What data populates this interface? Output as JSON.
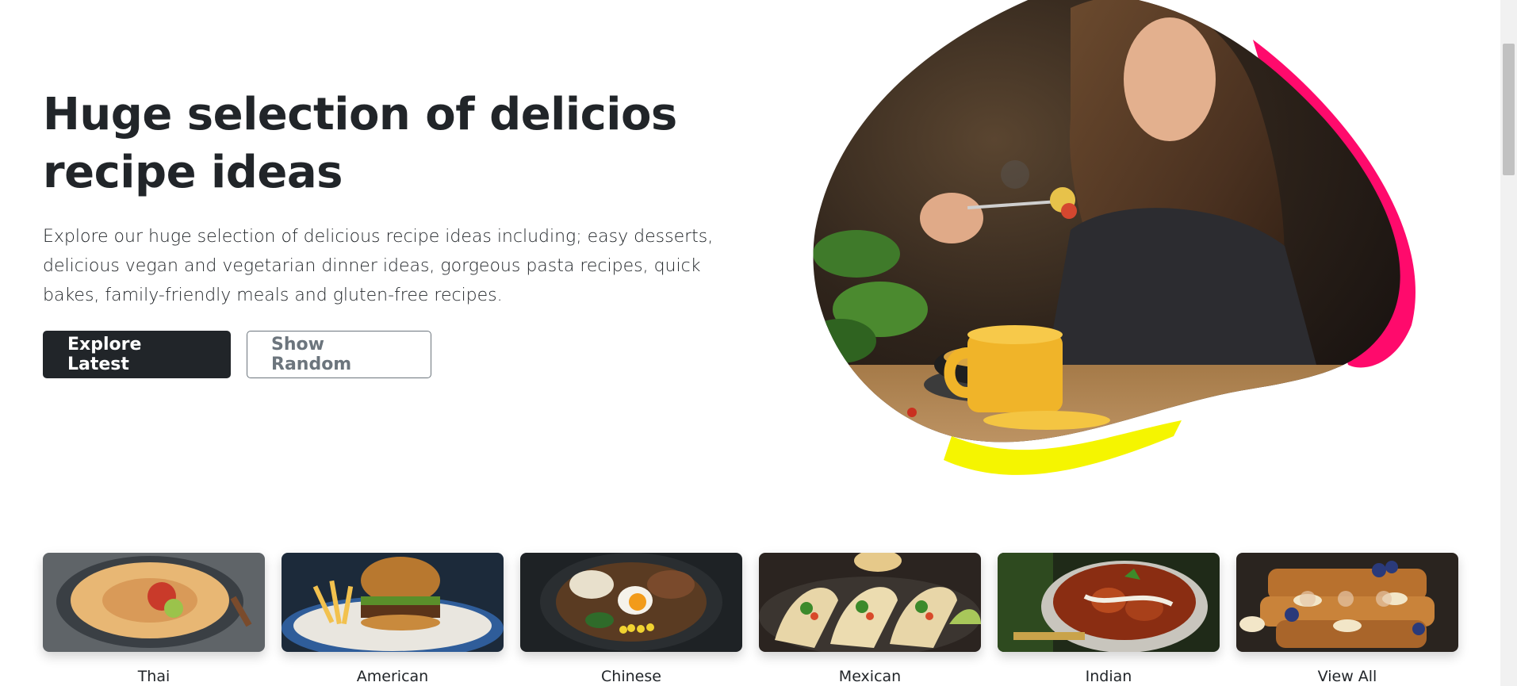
{
  "hero": {
    "title_line1": "Huge selection of delicios",
    "title_line2": "recipe ideas",
    "description_line1": "Explore our huge selection of delicious recipe ideas including; easy desserts,",
    "description_line2": "delicious vegan and vegetarian dinner ideas, gorgeous pasta recipes, quick",
    "description_line3": "bakes, family-friendly meals and gluten-free recipes.",
    "explore_button": "Explore Latest",
    "random_button": "Show Random",
    "image": "woman-eating-pasta-photo",
    "blob_accent_colors": [
      "#ff0a6c",
      "#f5f500"
    ]
  },
  "categories": [
    {
      "label": "Thai",
      "image": "thai-curry-noodle-bowl-photo"
    },
    {
      "label": "American",
      "image": "burger-and-fries-photo"
    },
    {
      "label": "Chinese",
      "image": "ramen-bowl-with-egg-photo"
    },
    {
      "label": "Mexican",
      "image": "tacos-photo"
    },
    {
      "label": "Indian",
      "image": "indian-curry-bowl-photo"
    },
    {
      "label": "View All",
      "image": "french-toast-with-berries-photo"
    }
  ],
  "colors": {
    "primary_dark": "#212529",
    "secondary_gray": "#6c757d"
  }
}
